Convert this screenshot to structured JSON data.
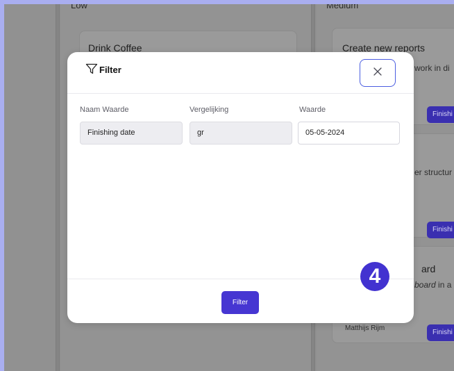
{
  "board": {
    "columns": [
      {
        "title": "Low"
      },
      {
        "title": "Medium"
      }
    ],
    "cards": [
      {
        "title": "Drink Coffee"
      },
      {
        "title": "Create new reports",
        "text": "work in di",
        "button": "Finishi"
      },
      {
        "text": "er structur",
        "button": "Finishi"
      },
      {
        "title": "ard",
        "text_italic": "board",
        "text_after": " in a"
      },
      {
        "author": "Matthijs Rijm",
        "button": "Finishi"
      }
    ]
  },
  "modal": {
    "title": "Filter",
    "icons": {
      "filter": "funnel-icon",
      "close": "close-icon"
    },
    "columns": {
      "name_label": "Naam Waarde",
      "comparison_label": "Vergelijking",
      "value_label": "Waarde"
    },
    "row": {
      "name": "Finishing date",
      "comparison": "gr",
      "value": "05-05-2024"
    },
    "submit_label": "Filter"
  },
  "step_badge": "4",
  "colors": {
    "accent": "#4636d2",
    "close_border": "#4a5de0",
    "frame": "#a9aef0"
  }
}
